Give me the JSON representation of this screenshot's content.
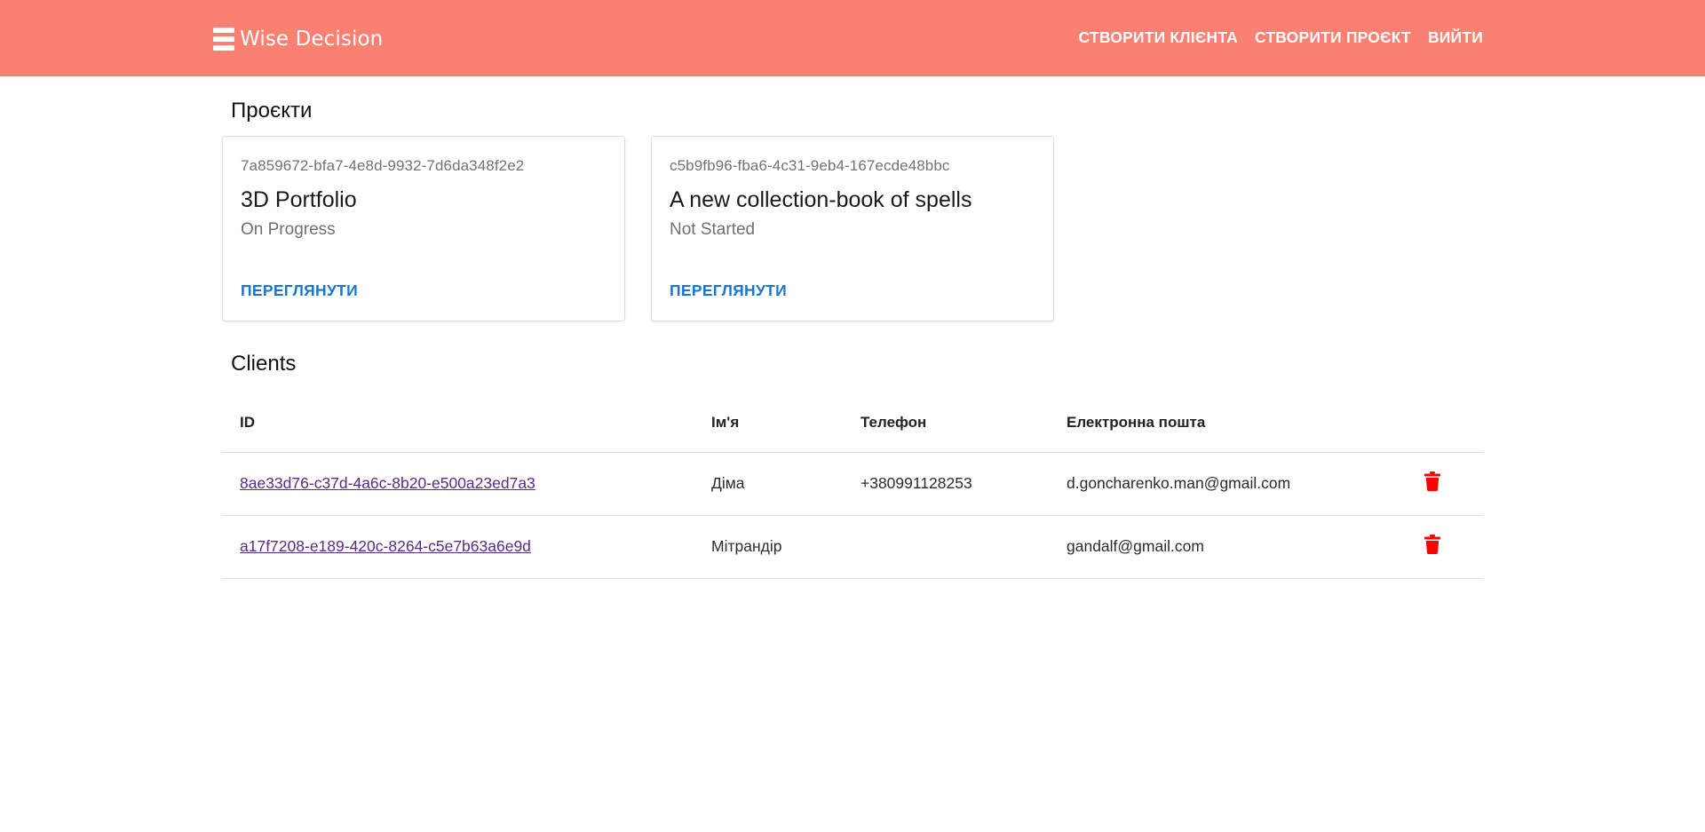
{
  "header": {
    "brand": "Wise Decision",
    "nav": [
      {
        "label": "СТВОРИТИ КЛІЄНТА"
      },
      {
        "label": "СТВОРИТИ ПРОЄКТ"
      },
      {
        "label": "ВИЙТИ"
      }
    ],
    "brand_icon": "menu-lines-icon",
    "colors": {
      "bar": "#fa8072"
    }
  },
  "projects": {
    "title": "Проєкти",
    "items": [
      {
        "id": "7a859672-bfa7-4e8d-9932-7d6da348f2e2",
        "name": "3D Portfolio",
        "status": "On Progress",
        "action": "ПЕРЕГЛЯНУТИ"
      },
      {
        "id": "c5b9fb96-fba6-4c31-9eb4-167ecde48bbc",
        "name": "A new collection-book of spells",
        "status": "Not Started",
        "action": "ПЕРЕГЛЯНУТИ"
      }
    ]
  },
  "clients": {
    "title": "Clients",
    "columns": [
      "ID",
      "Ім'я",
      "Телефон",
      "Електронна пошта"
    ],
    "rows": [
      {
        "id": "8ae33d76-c37d-4a6c-8b20-e500a23ed7a3",
        "name": "Діма",
        "phone": "+380991128253",
        "email": "d.goncharenko.man@gmail.com",
        "action_icon": "trash-icon"
      },
      {
        "id": "a17f7208-e189-420c-8264-c5e7b63a6e9d",
        "name": "Мітрандір",
        "phone": "",
        "email": "gandalf@gmail.com",
        "action_icon": "trash-icon"
      }
    ],
    "colors": {
      "delete": "#ff0000",
      "link": "#5b2a86"
    }
  }
}
